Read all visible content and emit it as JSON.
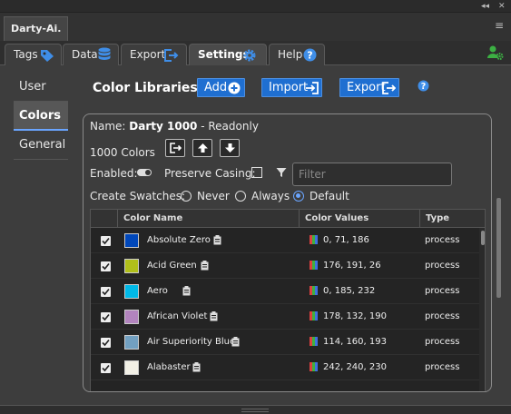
{
  "panel": {
    "title": "Darty-Ai."
  },
  "tabs": [
    {
      "label": "Tags"
    },
    {
      "label": "Data"
    },
    {
      "label": "Export"
    },
    {
      "label": "Settings"
    },
    {
      "label": "Help"
    }
  ],
  "sidenav": {
    "items": [
      "User",
      "Colors",
      "General"
    ]
  },
  "header": {
    "title": "Color Libraries",
    "add_label": "Add",
    "import_label": "Import",
    "export_label": "Export"
  },
  "library": {
    "name_label": "Name:",
    "name": "Darty 1000",
    "readonly": "- Readonly",
    "count_text": "1000 Colors",
    "enabled_label": "Enabled:",
    "preserve_label": "Preserve Casing:",
    "filter_placeholder": "Filter",
    "swatches_label": "Create Swatches:",
    "swatch_options": [
      "Never",
      "Always",
      "Default"
    ],
    "swatch_selected": "Default"
  },
  "table": {
    "columns": [
      "Color Name",
      "Color Values",
      "Type"
    ],
    "rows": [
      {
        "name": "Absolute Zero",
        "values": "0, 71, 186",
        "type": "process",
        "color": "#0047ba"
      },
      {
        "name": "Acid Green",
        "values": "176, 191, 26",
        "type": "process",
        "color": "#b0bf1a"
      },
      {
        "name": "Aero",
        "values": "0, 185, 232",
        "type": "process",
        "color": "#00b9e8"
      },
      {
        "name": "African Violet",
        "values": "178, 132, 190",
        "type": "process",
        "color": "#b284be"
      },
      {
        "name": "Air Superiority Blue",
        "values": "114, 160, 193",
        "type": "process",
        "color": "#72a0c1"
      },
      {
        "name": "Alabaster",
        "values": "242, 240, 230",
        "type": "process",
        "color": "#f2f0e6"
      }
    ]
  },
  "colors": {
    "accent": "#1f6fd1",
    "highlight": "#6aa5ff",
    "green": "#3cb043"
  }
}
